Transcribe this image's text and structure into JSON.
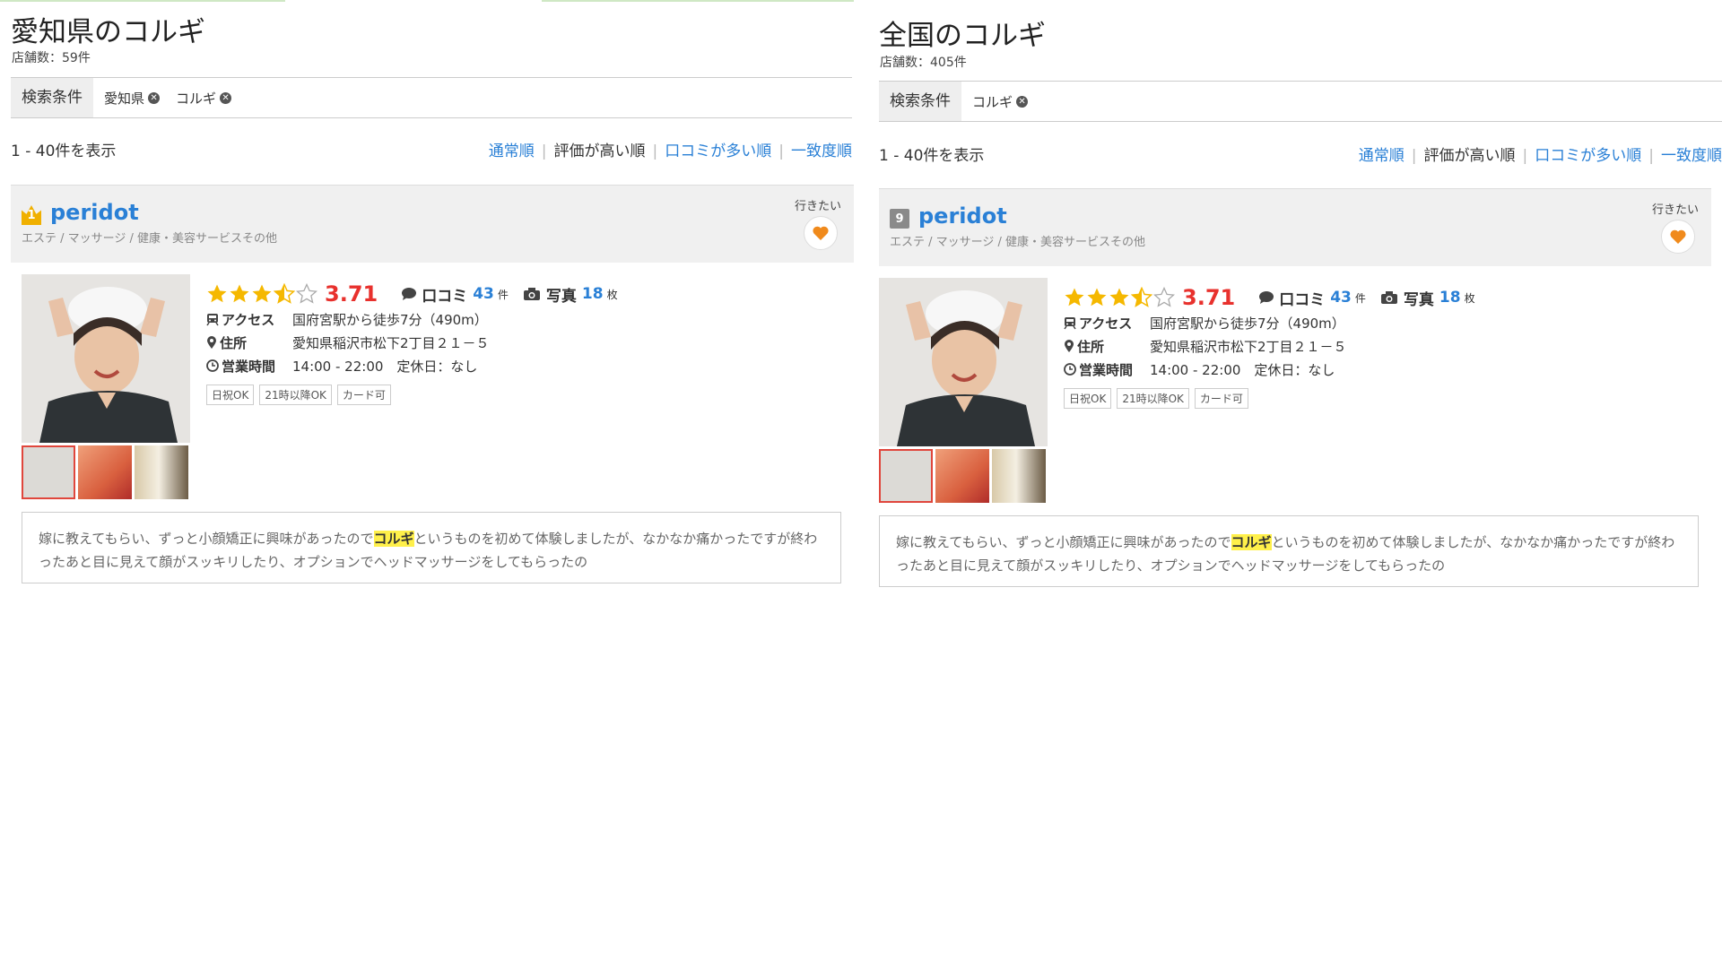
{
  "left": {
    "title": "愛知県のコルギ",
    "store_count": "店舗数：59件",
    "filter": {
      "label": "検索条件",
      "chips": [
        "愛知県",
        "コルギ"
      ]
    },
    "range": "1 - 40件を表示",
    "sort": [
      "通常順",
      "評価が高い順",
      "口コミが多い順",
      "一致度順"
    ],
    "result": {
      "rank": "1",
      "name": "peridot",
      "category": "エステ / マッサージ / 健康・美容サービスその他",
      "want_label": "行きたい",
      "score": "3.71",
      "reviews_label": "口コミ",
      "reviews_count": "43",
      "reviews_unit": "件",
      "photos_label": "写真",
      "photos_count": "18",
      "photos_unit": "枚",
      "access_label": "アクセス",
      "access": "国府宮駅から徒歩7分（490m）",
      "address_label": "住所",
      "address": "愛知県稲沢市松下2丁目２１－５",
      "hours_label": "営業時間",
      "hours": "14:00 - 22:00　定休日：なし",
      "tags": [
        "日祝OK",
        "21時以降OK",
        "カード可"
      ],
      "review_pre": "嫁に教えてもらい、ずっと小顔矯正に興味があったので",
      "review_hl": "コルギ",
      "review_post": "というものを初めて体験しましたが、なかなか痛かったですが終わったあと目に見えて顔がスッキリしたり、オプションでヘッドマッサージをしてもらったの"
    }
  },
  "right": {
    "title": "全国のコルギ",
    "store_count": "店舗数：405件",
    "filter": {
      "label": "検索条件",
      "chips": [
        "コルギ"
      ]
    },
    "range": "1 - 40件を表示",
    "sort": [
      "通常順",
      "評価が高い順",
      "口コミが多い順",
      "一致度順"
    ],
    "result": {
      "rank": "9",
      "name": "peridot",
      "category": "エステ / マッサージ / 健康・美容サービスその他",
      "want_label": "行きたい",
      "score": "3.71",
      "reviews_label": "口コミ",
      "reviews_count": "43",
      "reviews_unit": "件",
      "photos_label": "写真",
      "photos_count": "18",
      "photos_unit": "枚",
      "access_label": "アクセス",
      "access": "国府宮駅から徒歩7分（490m）",
      "address_label": "住所",
      "address": "愛知県稲沢市松下2丁目２１－５",
      "hours_label": "営業時間",
      "hours": "14:00 - 22:00　定休日：なし",
      "tags": [
        "日祝OK",
        "21時以降OK",
        "カード可"
      ],
      "review_pre": "嫁に教えてもらい、ずっと小顔矯正に興味があったので",
      "review_hl": "コルギ",
      "review_post": "というものを初めて体験しましたが、なかなか痛かったですが終わったあと目に見えて顔がスッキリしたり、オプションでヘッドマッサージをしてもらったの"
    }
  },
  "colors": {
    "link": "#2a80d6",
    "score": "#e8312d",
    "star": "#f5b800",
    "heart": "#f08a1c",
    "highlight": "#fff04a"
  }
}
